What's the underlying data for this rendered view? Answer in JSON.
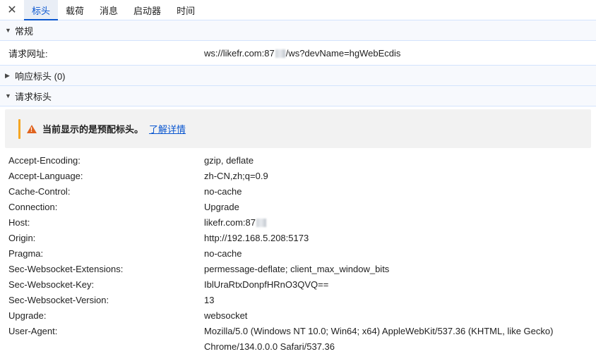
{
  "tabs": {
    "close_glyph": "✕",
    "items": [
      "标头",
      "载荷",
      "消息",
      "启动器",
      "时间"
    ]
  },
  "general": {
    "title": "常规",
    "url_label": "请求网址:",
    "url_prefix": "ws://likefr.com:87",
    "url_suffix": "/ws?devName=hgWebEcdis"
  },
  "response": {
    "title": "响应标头 (0)"
  },
  "request": {
    "title": "请求标头",
    "warning_text": "当前显示的是预配标头。",
    "warning_link": "了解详情",
    "warning_color": "#e0631e",
    "headers": [
      {
        "key": "Accept-Encoding:",
        "value": "gzip, deflate"
      },
      {
        "key": "Accept-Language:",
        "value": "zh-CN,zh;q=0.9"
      },
      {
        "key": "Cache-Control:",
        "value": "no-cache"
      },
      {
        "key": "Connection:",
        "value": "Upgrade"
      },
      {
        "key": "Host:",
        "value": "likefr.com:87"
      },
      {
        "key": "Origin:",
        "value": "http://192.168.5.208:5173"
      },
      {
        "key": "Pragma:",
        "value": "no-cache"
      },
      {
        "key": "Sec-Websocket-Extensions:",
        "value": "permessage-deflate; client_max_window_bits"
      },
      {
        "key": "Sec-Websocket-Key:",
        "value": "IblUraRtxDonpfHRnO3QVQ=="
      },
      {
        "key": "Sec-Websocket-Version:",
        "value": "13"
      },
      {
        "key": "Upgrade:",
        "value": "websocket"
      },
      {
        "key": "User-Agent:",
        "value": "Mozilla/5.0 (Windows NT 10.0; Win64; x64) AppleWebKit/537.36 (KHTML, like Gecko)"
      },
      {
        "key": "",
        "value": "Chrome/134.0.0.0 Safari/537.36"
      }
    ]
  },
  "accent_color": "#0b57d0"
}
